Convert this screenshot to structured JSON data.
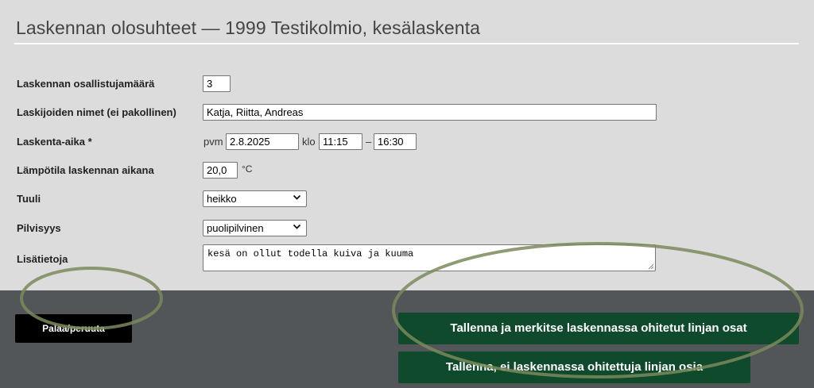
{
  "page": {
    "title": "Laskennan olosuhteet — 1999 Testikolmio, kesälaskenta"
  },
  "form": {
    "participants": {
      "label": "Laskennan osallistujamäärä",
      "value": "3"
    },
    "names": {
      "label": "Laskijoiden nimet (ei pakollinen)",
      "value": "Katja, Riitta, Andreas"
    },
    "time": {
      "label": "Laskenta-aika *",
      "date_prefix": "pvm",
      "date": "2.8.2025",
      "time_prefix": "klo",
      "start": "11:15",
      "separator": "–",
      "end": "16:30"
    },
    "temperature": {
      "label": "Lämpötila laskennan aikana",
      "value": "20,0",
      "unit": "°C"
    },
    "wind": {
      "label": "Tuuli",
      "selected": "heikko"
    },
    "clouds": {
      "label": "Pilvisyys",
      "selected": "puolipilvinen"
    },
    "notes": {
      "label": "Lisätietoja",
      "value": "kesä on ollut todella kuiva ja kuuma"
    }
  },
  "actions": {
    "back": "Palaa/peruuta",
    "save_mark": "Tallenna ja merkitse laskennassa ohitetut linjan osat",
    "save_nomark": "Tallenna, ei laskennassa ohitettuja linjan osia"
  },
  "colors": {
    "form_background": "#dcdcdc",
    "bar_background": "#525658",
    "primary_button": "#0f4a2c",
    "back_button": "#000000",
    "annotation_stroke": "#7a8a5c"
  },
  "icons": {
    "select_arrow": "chevron-down-icon",
    "textarea_grip": "resize-grip-icon"
  }
}
